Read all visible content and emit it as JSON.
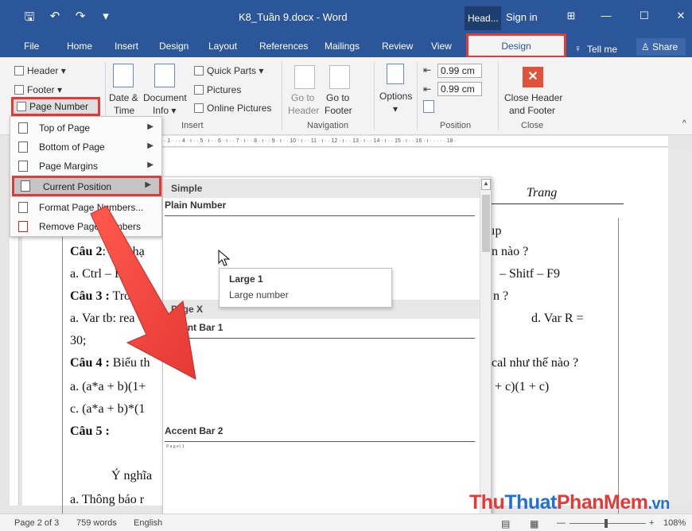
{
  "titlebar": {
    "doc_title": "K8_Tuần 9.docx - Word",
    "context_head": "Head...",
    "signin": "Sign in",
    "controls": [
      "⊞",
      "—",
      "☐",
      "✕"
    ]
  },
  "tabs": {
    "items": [
      "File",
      "Home",
      "Insert",
      "Design",
      "Layout",
      "References",
      "Mailings",
      "Review",
      "View"
    ],
    "contextual": "Design",
    "tellme": "Tell me",
    "share": "Share"
  },
  "ribbon": {
    "header": "Header",
    "footer": "Footer",
    "page_number": "Page Number",
    "date_time_1": "Date &",
    "date_time_2": "Time",
    "document_info_1": "Document",
    "document_info_2": "Info",
    "quick_parts": "Quick Parts",
    "pictures": "Pictures",
    "online_pictures": "Online Pictures",
    "goto_header_1": "Go to",
    "goto_header_2": "Header",
    "goto_footer_1": "Go to",
    "goto_footer_2": "Footer",
    "options": "Options",
    "header_pos": "0.99 cm",
    "footer_pos": "0.99 cm",
    "close_1": "Close Header",
    "close_2": "and Footer",
    "groups": {
      "insert": "Insert",
      "navigation": "Navigation",
      "position": "Position",
      "close": "Close"
    }
  },
  "ruler": {
    "text": "· 1 · · · 4 · ı · · 5 · ı · · 6 · ı · · 7 · ı · · 8 · ı · · 9 · ı · · 10 · ı · · 11 · ı · · 12 · ı · · 13 · ı · · 14 · ı · · 15 · ı · · 16 · ı · · · · · 18 ·"
  },
  "page_number_menu": {
    "items": [
      {
        "label": "Top of Page",
        "submenu": true
      },
      {
        "label": "Bottom of Page",
        "submenu": true
      },
      {
        "label": "Page Margins",
        "submenu": true
      },
      {
        "label": "Current Position",
        "submenu": true
      },
      {
        "label": "Format Page Numbers...",
        "submenu": false
      },
      {
        "label": "Remove Page Numbers",
        "submenu": false
      }
    ]
  },
  "gallery": {
    "section_simple": "Simple",
    "plain_number": "Plain Number",
    "section_pagex": "Page X",
    "accent_bar_1": "Accent Bar 1",
    "accent_bar_2": "Accent Bar 2",
    "preview_pagex": "P a g e | 1"
  },
  "tooltip": {
    "title": "Large 1",
    "desc": "Large number"
  },
  "document": {
    "header_right": "Trang",
    "lines": [
      {
        "key": "Câu 2",
        "rest": ": Để chạ",
        "right": "n nào ?"
      },
      {
        "key": "",
        "rest": "a. Ctrl – F9",
        "right": "– Shitf – F9"
      },
      {
        "key": "Câu 3 :",
        "rest": " Trong",
        "right": "n ?"
      },
      {
        "key": "",
        "rest": "a. Var  tb: rea",
        "right": "d. Var  R ="
      },
      {
        "key": "",
        "rest": "30;",
        "right": ""
      },
      {
        "key": "Câu 4 :",
        "rest": " Biểu th",
        "right": "cal như thế nào ?"
      },
      {
        "key": "",
        "rest": "a. (a*a + b)(1+",
        "right": "+ c)(1 + c)"
      },
      {
        "key": "",
        "rest": "c. (a*a + b)*(1",
        "right": ""
      },
      {
        "key": "Câu 5 :",
        "rest": "",
        "right": ""
      },
      {
        "key": "",
        "rest": "Ý nghĩa",
        "right": ""
      },
      {
        "key": "",
        "rest": "a. Thông báo r",
        "right": ""
      }
    ],
    "top_right": "ıp"
  },
  "status": {
    "page": "Page 2 of 3",
    "words": "759 words",
    "lang": "English",
    "zoom": "108%"
  },
  "watermark": {
    "part1": "Thu",
    "part2": "Thuat",
    "part3": "PhanMem",
    "part4": ".vn"
  },
  "colors": {
    "title_blue": "#2b579a",
    "highlight_red": "#e53935",
    "close_orange": "#e0533a"
  }
}
